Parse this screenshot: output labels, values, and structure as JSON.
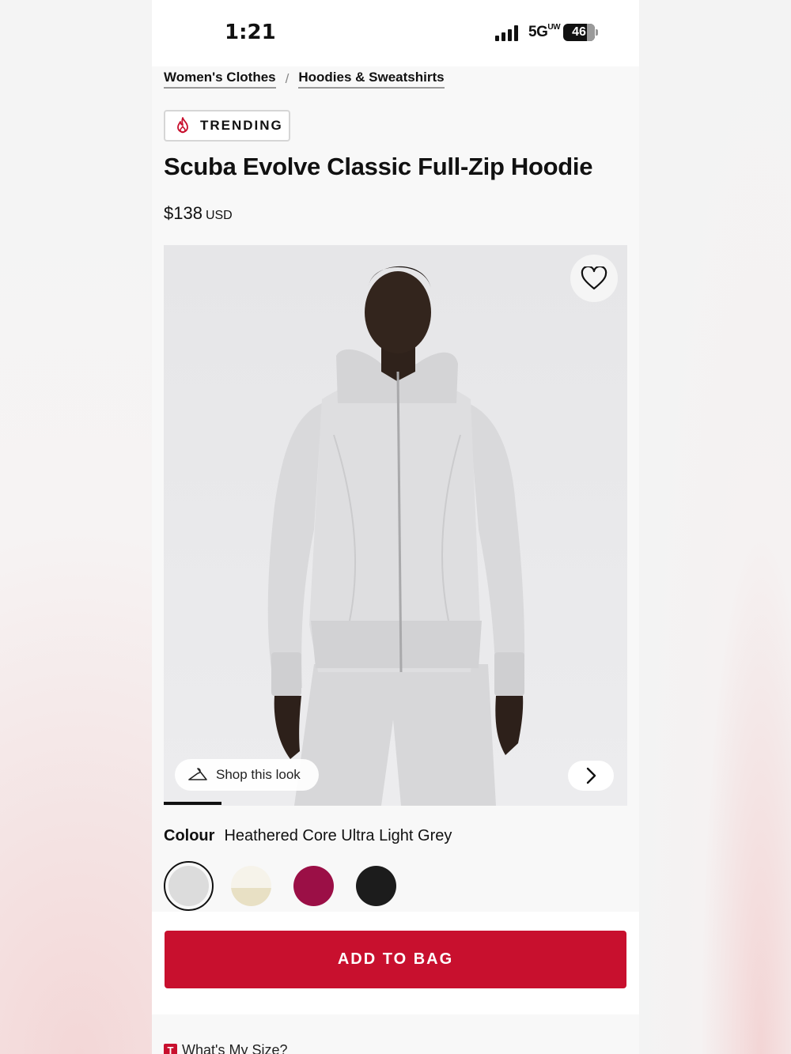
{
  "status_bar": {
    "time": "1:21",
    "network": "5G",
    "network_suffix": "UW",
    "battery": "46"
  },
  "breadcrumb": {
    "items": [
      "Women's Clothes",
      "Hoodies & Sweatshirts"
    ],
    "separator": "/"
  },
  "badge": {
    "label": "TRENDING",
    "icon": "flame-icon",
    "color": "#c8102e"
  },
  "product": {
    "title": "Scuba Evolve Classic Full-Zip Hoodie",
    "price": "$138",
    "currency": "USD"
  },
  "gallery": {
    "shop_look_label": "Shop this look",
    "progress": 0.125
  },
  "colour": {
    "label": "Colour",
    "selected": "Heathered Core Ultra Light Grey",
    "swatches": [
      {
        "name": "heathered-core-ultra-light-grey",
        "color": "#dcdcdc",
        "selected": true
      },
      {
        "name": "bone-two-tone",
        "color": "#efe9d7",
        "selected": false
      },
      {
        "name": "magenta",
        "color": "#9b0f46",
        "selected": false
      },
      {
        "name": "black",
        "color": "#1c1c1c",
        "selected": false
      }
    ]
  },
  "actions": {
    "add_to_bag": "ADD TO BAG",
    "size_help": "What's My Size?",
    "size_help_badge": "T"
  },
  "accent_color": "#c8102e"
}
